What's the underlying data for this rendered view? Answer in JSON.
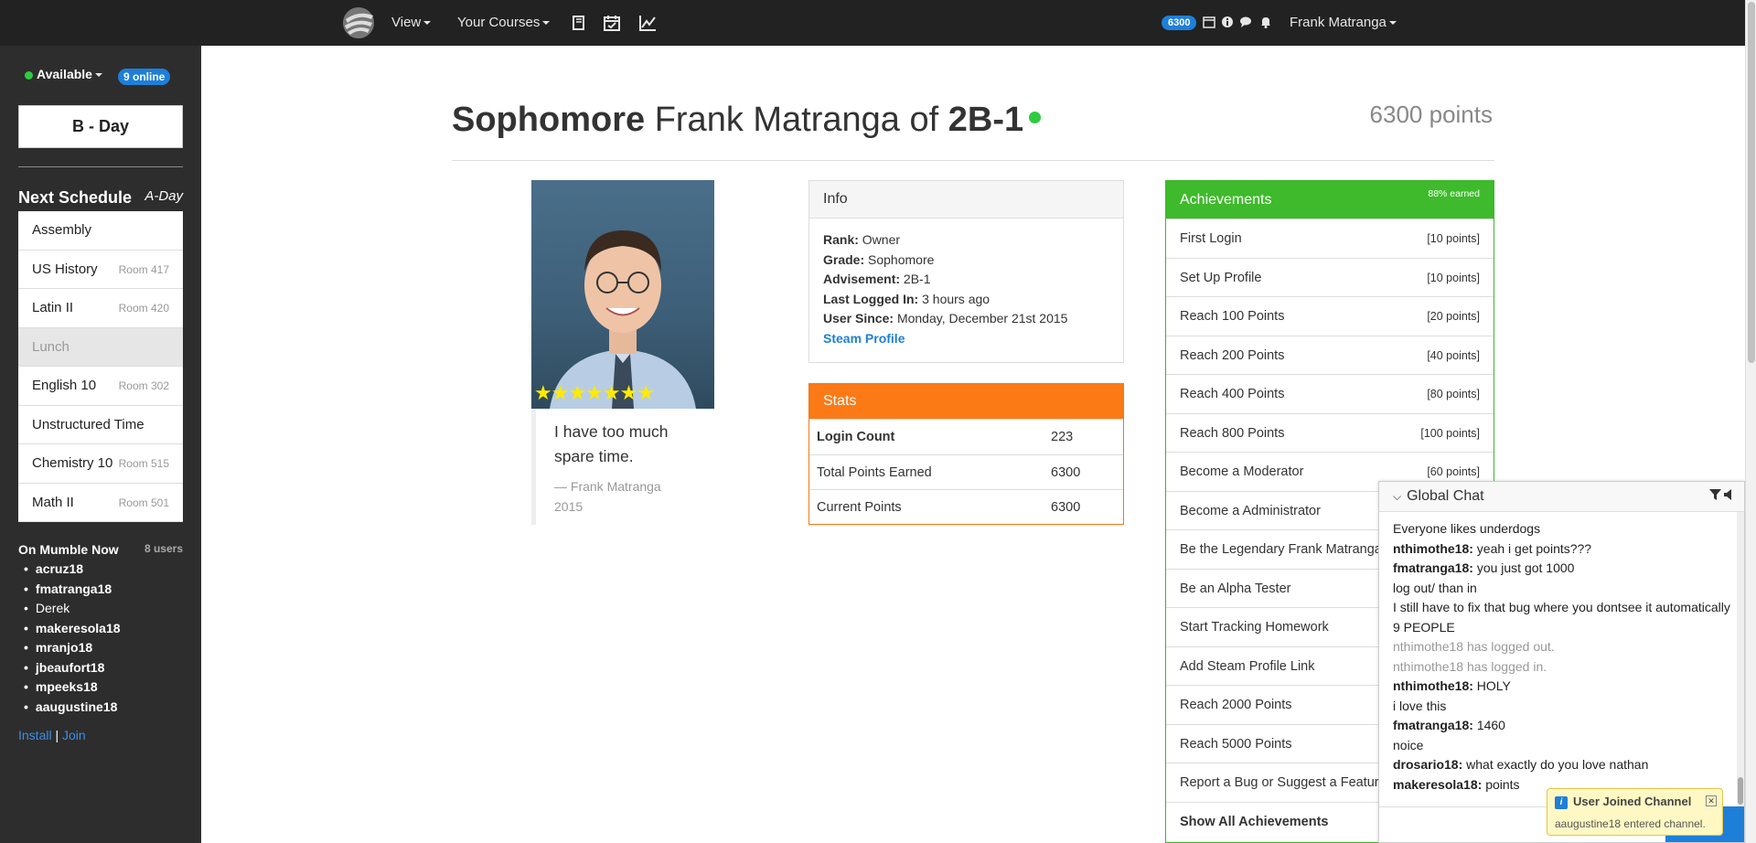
{
  "nav": {
    "view": "View",
    "courses": "Your Courses",
    "points_badge": "6300",
    "user": "Frank Matranga"
  },
  "sidebar": {
    "status": "Available",
    "online": "9 online",
    "day": "B - Day",
    "next_schedule": "Next Schedule",
    "next_day": "A-Day",
    "schedule": [
      {
        "name": "Assembly",
        "room": ""
      },
      {
        "name": "US History",
        "room": "Room 417"
      },
      {
        "name": "Latin II",
        "room": "Room 420"
      },
      {
        "name": "Lunch",
        "room": ""
      },
      {
        "name": "English 10",
        "room": "Room 302"
      },
      {
        "name": "Unstructured Time",
        "room": ""
      },
      {
        "name": "Chemistry 10",
        "room": "Room 515"
      },
      {
        "name": "Math II",
        "room": "Room 501"
      }
    ],
    "mumble_title": "On Mumble Now",
    "mumble_count": "8 users",
    "mumble_users": [
      "acruz18",
      "fmatranga18",
      "Derek",
      "makeresola18",
      "mranjo18",
      "jbeaufort18",
      "mpeeks18",
      "aaugustine18"
    ],
    "install": "Install",
    "join": "Join",
    "sep": "|"
  },
  "profile": {
    "grade_title": "Sophomore",
    "name": "Frank Matranga",
    "of": "of",
    "advisement": "2B-1",
    "points": "6300 points",
    "stars": "★★★★★★★",
    "quote": "I have too much spare time.",
    "quote_author": "— Frank Matranga",
    "quote_year": "2015"
  },
  "info": {
    "title": "Info",
    "rank_label": "Rank:",
    "rank": "Owner",
    "grade_label": "Grade:",
    "grade": "Sophomore",
    "adv_label": "Advisement:",
    "adv": "2B-1",
    "last_label": "Last Logged In:",
    "last": "3 hours ago",
    "since_label": "User Since:",
    "since": "Monday, December 21st 2015",
    "steam": "Steam Profile"
  },
  "stats": {
    "title": "Stats",
    "rows": [
      {
        "label": "Login Count",
        "value": "223"
      },
      {
        "label": "Total Points Earned",
        "value": "6300"
      },
      {
        "label": "Current Points",
        "value": "6300"
      }
    ]
  },
  "achievements": {
    "title": "Achievements",
    "earned": "88% earned",
    "items": [
      {
        "name": "First Login",
        "points": "[10 points]"
      },
      {
        "name": "Set Up Profile",
        "points": "[10 points]"
      },
      {
        "name": "Reach 100 Points",
        "points": "[20 points]"
      },
      {
        "name": "Reach 200 Points",
        "points": "[40 points]"
      },
      {
        "name": "Reach 400 Points",
        "points": "[80 points]"
      },
      {
        "name": "Reach 800 Points",
        "points": "[100 points]"
      },
      {
        "name": "Become a Moderator",
        "points": "[60 points]"
      },
      {
        "name": "Become a Administrator",
        "points": ""
      },
      {
        "name": "Be the Legendary Frank Matranga",
        "points": ""
      },
      {
        "name": "Be an Alpha Tester",
        "points": ""
      },
      {
        "name": "Start Tracking Homework",
        "points": ""
      },
      {
        "name": "Add Steam Profile Link",
        "points": ""
      },
      {
        "name": "Reach 2000 Points",
        "points": ""
      },
      {
        "name": "Reach 5000 Points",
        "points": ""
      },
      {
        "name": "Report a Bug or Suggest a Feature",
        "points": ""
      }
    ],
    "show_all": "Show All Achievements"
  },
  "chat": {
    "title": "Global Chat",
    "messages": [
      {
        "user": "",
        "text": "Everyone likes underdogs",
        "sys": false
      },
      {
        "user": "nthimothe18:",
        "text": "yeah i get points???",
        "sys": false
      },
      {
        "user": "fmatranga18:",
        "text": "you just got 1000",
        "sys": false
      },
      {
        "user": "",
        "text": "log out/ than in",
        "sys": false
      },
      {
        "user": "",
        "text": "I still have to fix that bug where you dontsee it automatically",
        "sys": false
      },
      {
        "user": "",
        "text": "9 PEOPLE",
        "sys": false
      },
      {
        "user": "",
        "text": "nthimothe18 has logged out.",
        "sys": true
      },
      {
        "user": "",
        "text": "nthimothe18 has logged in.",
        "sys": true
      },
      {
        "user": "nthimothe18:",
        "text": "HOLY",
        "sys": false
      },
      {
        "user": "",
        "text": "i love this",
        "sys": false
      },
      {
        "user": "fmatranga18:",
        "text": "1460",
        "sys": false
      },
      {
        "user": "",
        "text": "noice",
        "sys": false
      },
      {
        "user": "drosario18:",
        "text": "what exactly do you love nathan",
        "sys": false
      },
      {
        "user": "makeresola18:",
        "text": "points",
        "sys": false
      }
    ]
  },
  "notification": {
    "title": "User Joined Channel",
    "text": "aaugustine18 entered channel.",
    "close": "✕",
    "info": "i"
  }
}
